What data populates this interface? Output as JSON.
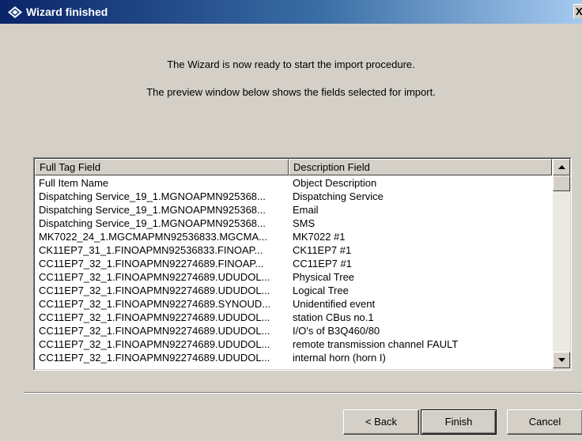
{
  "window": {
    "title": "Wizard finished",
    "close_label": "X"
  },
  "intro": {
    "line1": "The Wizard is now ready to start the import procedure.",
    "line2": "The preview window below shows the fields selected for import."
  },
  "preview": {
    "columns": [
      "Full Tag Field",
      "Description Field"
    ],
    "rows": [
      [
        "Full Item Name",
        "Object Description"
      ],
      [
        "Dispatching Service_19_1.MGNOAPMN925368...",
        "Dispatching Service"
      ],
      [
        "Dispatching Service_19_1.MGNOAPMN925368...",
        "Email"
      ],
      [
        "Dispatching Service_19_1.MGNOAPMN925368...",
        "SMS"
      ],
      [
        "MK7022_24_1.MGCMAPMN92536833.MGCMA...",
        "MK7022 #1"
      ],
      [
        "CK11EP7_31_1.FINOAPMN92536833.FINOAP...",
        "CK11EP7 #1"
      ],
      [
        "CC11EP7_32_1.FINOAPMN92274689.FINOAP...",
        "CC11EP7 #1"
      ],
      [
        "CC11EP7_32_1.FINOAPMN92274689.UDUDOL...",
        "Physical Tree"
      ],
      [
        "CC11EP7_32_1.FINOAPMN92274689.UDUDOL...",
        "Logical Tree"
      ],
      [
        "CC11EP7_32_1.FINOAPMN92274689.SYNOUD...",
        "Unidentified event"
      ],
      [
        "CC11EP7_32_1.FINOAPMN92274689.UDUDOL...",
        "station CBus no.1"
      ],
      [
        "CC11EP7_32_1.FINOAPMN92274689.UDUDOL...",
        "I/O's of B3Q460/80"
      ],
      [
        "CC11EP7_32_1.FINOAPMN92274689.UDUDOL...",
        "remote transmission channel FAULT"
      ],
      [
        "CC11EP7_32_1.FINOAPMN92274689.UDUDOL...",
        "internal horn (horn I)"
      ]
    ]
  },
  "buttons": {
    "back": "< Back",
    "finish": "Finish",
    "cancel": "Cancel"
  },
  "colors": {
    "title_bar_start": "#0a246a",
    "title_bar_end": "#a6caf0",
    "dialog_background": "#d4d0c8"
  },
  "icons": {
    "app": "diamond-wizard-icon",
    "scroll_up": "arrow-up-icon",
    "scroll_down": "arrow-down-icon"
  }
}
